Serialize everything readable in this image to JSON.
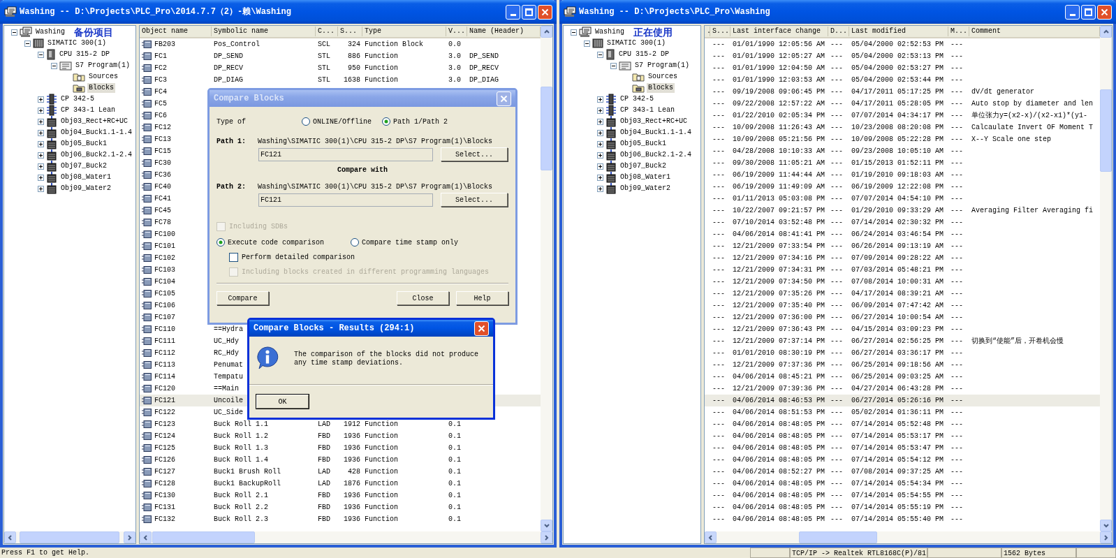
{
  "left_window": {
    "title": "Washing -- D:\\Projects\\PLC_Pro\\2014.7.7（2）-赖\\Washing",
    "tree": [
      {
        "label": "Washing",
        "kind": "project",
        "note": "备份项目",
        "expanded": true,
        "selected": false,
        "children": [
          {
            "label": "SIMATIC 300(1)",
            "kind": "station",
            "expanded": true,
            "selected": false,
            "children": [
              {
                "label": "CPU 315-2 DP",
                "kind": "cpu",
                "expanded": true,
                "selected": false,
                "children": [
                  {
                    "label": "S7 Program(1)",
                    "kind": "program",
                    "expanded": true,
                    "selected": false,
                    "children": [
                      {
                        "label": "Sources",
                        "kind": "sources",
                        "selected": false
                      },
                      {
                        "label": "Blocks",
                        "kind": "blocks",
                        "selected": true
                      }
                    ]
                  }
                ]
              },
              {
                "label": "CP 342-5",
                "kind": "cp",
                "expanded": false,
                "selected": false
              },
              {
                "label": "CP 343-1 Lean",
                "kind": "cp",
                "expanded": false,
                "selected": false
              },
              {
                "label": "Obj03_Rect+RC+UC",
                "kind": "object",
                "expanded": false,
                "selected": false
              },
              {
                "label": "Obj04_Buck1.1-1.4",
                "kind": "object",
                "expanded": false,
                "selected": false
              },
              {
                "label": "Obj05_Buck1",
                "kind": "object",
                "expanded": false,
                "selected": false
              },
              {
                "label": "Obj06_Buck2.1-2.4",
                "kind": "object",
                "expanded": false,
                "selected": false
              },
              {
                "label": "Obj07_Buck2",
                "kind": "object",
                "expanded": false,
                "selected": false
              },
              {
                "label": "Obj08_Water1",
                "kind": "object",
                "expanded": false,
                "selected": false
              },
              {
                "label": "Obj09_Water2",
                "kind": "object",
                "expanded": false,
                "selected": false
              }
            ]
          }
        ]
      }
    ],
    "table": {
      "columns": [
        "Object name",
        "Symbolic name",
        "C...",
        "S...",
        "Type",
        "V...",
        "Name (Header)"
      ],
      "rows": [
        {
          "name": "FB203",
          "symbolic": "Pos_Control",
          "lang": "SCL",
          "size": "324",
          "type": "Function Block",
          "version": "0.0",
          "selected": false
        },
        {
          "name": "FC1",
          "symbolic": "DP_SEND",
          "lang": "STL",
          "size": "886",
          "type": "Function",
          "version": "3.0",
          "header": "DP_SEND",
          "selected": false
        },
        {
          "name": "FC2",
          "symbolic": "DP_RECV",
          "lang": "STL",
          "size": "950",
          "type": "Function",
          "version": "3.0",
          "header": "DP_RECV",
          "selected": false
        },
        {
          "name": "FC3",
          "symbolic": "DP_DIAG",
          "lang": "STL",
          "size": "1638",
          "type": "Function",
          "version": "3.0",
          "header": "DP_DIAG",
          "selected": false
        },
        {
          "name": "FC4",
          "selected": false
        },
        {
          "name": "FC5",
          "selected": false
        },
        {
          "name": "FC6",
          "selected": false
        },
        {
          "name": "FC12",
          "selected": false
        },
        {
          "name": "FC13",
          "selected": false
        },
        {
          "name": "FC15",
          "selected": false
        },
        {
          "name": "FC30",
          "selected": false
        },
        {
          "name": "FC36",
          "selected": false
        },
        {
          "name": "FC40",
          "selected": false
        },
        {
          "name": "FC41",
          "selected": false
        },
        {
          "name": "FC45",
          "selected": false
        },
        {
          "name": "FC78",
          "selected": false
        },
        {
          "name": "FC100",
          "selected": false
        },
        {
          "name": "FC101",
          "selected": false
        },
        {
          "name": "FC102",
          "selected": false
        },
        {
          "name": "FC103",
          "selected": false
        },
        {
          "name": "FC104",
          "selected": false
        },
        {
          "name": "FC105",
          "selected": false
        },
        {
          "name": "FC106",
          "selected": false
        },
        {
          "name": "FC107",
          "selected": false
        },
        {
          "name": "FC110",
          "symbolic": "==Hydra",
          "selected": false
        },
        {
          "name": "FC111",
          "symbolic": "UC_Hdy",
          "selected": false
        },
        {
          "name": "FC112",
          "symbolic": "RC_Hdy",
          "selected": false
        },
        {
          "name": "FC113",
          "symbolic": "Penumat",
          "selected": false
        },
        {
          "name": "FC114",
          "symbolic": "Tempatu",
          "selected": false
        },
        {
          "name": "FC120",
          "symbolic": "==Main",
          "selected": false
        },
        {
          "name": "FC121",
          "symbolic": "Uncoile",
          "selected": true
        },
        {
          "name": "FC122",
          "symbolic": "UC_Side",
          "selected": false
        },
        {
          "name": "FC123",
          "symbolic": "Buck Roll 1.1",
          "lang": "LAD",
          "size": "1912",
          "type": "Function",
          "version": "0.1",
          "selected": false
        },
        {
          "name": "FC124",
          "symbolic": "Buck Roll 1.2",
          "lang": "FBD",
          "size": "1936",
          "type": "Function",
          "version": "0.1",
          "selected": false
        },
        {
          "name": "FC125",
          "symbolic": "Buck Roll 1.3",
          "lang": "FBD",
          "size": "1936",
          "type": "Function",
          "version": "0.1",
          "selected": false
        },
        {
          "name": "FC126",
          "symbolic": "Buck Roll 1.4",
          "lang": "FBD",
          "size": "1936",
          "type": "Function",
          "version": "0.1",
          "selected": false
        },
        {
          "name": "FC127",
          "symbolic": "Buck1 Brush Roll",
          "lang": "LAD",
          "size": "428",
          "type": "Function",
          "version": "0.1",
          "selected": false
        },
        {
          "name": "FC128",
          "symbolic": "Buck1 BackupRoll",
          "lang": "LAD",
          "size": "1876",
          "type": "Function",
          "version": "0.1",
          "selected": false
        },
        {
          "name": "FC130",
          "symbolic": "Buck Roll 2.1",
          "lang": "FBD",
          "size": "1936",
          "type": "Function",
          "version": "0.1",
          "selected": false
        },
        {
          "name": "FC131",
          "symbolic": "Buck Roll 2.2",
          "lang": "FBD",
          "size": "1936",
          "type": "Function",
          "version": "0.1",
          "selected": false
        },
        {
          "name": "FC132",
          "symbolic": "Buck Roll 2.3",
          "lang": "FBD",
          "size": "1936",
          "type": "Function",
          "version": "0.1",
          "selected": false
        }
      ]
    }
  },
  "right_window": {
    "title": "Washing -- D:\\Projects\\PLC_Pro\\Washing",
    "tree": [
      {
        "label": "Washing",
        "kind": "project",
        "note": "正在使用",
        "expanded": true,
        "selected": false,
        "children": [
          {
            "label": "SIMATIC 300(1)",
            "kind": "station",
            "expanded": true,
            "selected": false,
            "children": [
              {
                "label": "CPU 315-2 DP",
                "kind": "cpu",
                "expanded": true,
                "selected": false,
                "children": [
                  {
                    "label": "S7 Program(1)",
                    "kind": "program",
                    "expanded": true,
                    "selected": false,
                    "children": [
                      {
                        "label": "Sources",
                        "kind": "sources",
                        "selected": false
                      },
                      {
                        "label": "Blocks",
                        "kind": "blocks",
                        "selected": true
                      }
                    ]
                  }
                ]
              },
              {
                "label": "CP 342-5",
                "kind": "cp",
                "expanded": false,
                "selected": false
              },
              {
                "label": "CP 343-1 Lean",
                "kind": "cp",
                "expanded": false,
                "selected": false
              },
              {
                "label": "Obj03_Rect+RC+UC",
                "kind": "object",
                "expanded": false,
                "selected": false
              },
              {
                "label": "Obj04_Buck1.1-1.4",
                "kind": "object",
                "expanded": false,
                "selected": false
              },
              {
                "label": "Obj05_Buck1",
                "kind": "object",
                "expanded": false,
                "selected": false
              },
              {
                "label": "Obj06_Buck2.1-2.4",
                "kind": "object",
                "expanded": false,
                "selected": false
              },
              {
                "label": "Obj07_Buck2",
                "kind": "object",
                "expanded": false,
                "selected": false
              },
              {
                "label": "Obj08_Water1",
                "kind": "object",
                "expanded": false,
                "selected": false
              },
              {
                "label": "Obj09_Water2",
                "kind": "object",
                "expanded": false,
                "selected": false
              }
            ]
          }
        ]
      }
    ],
    "table": {
      "columns": [
        ".",
        "S...",
        "Last interface change",
        "D...",
        "Last modified",
        "M...",
        "Comment"
      ],
      "rows": [
        {
          "s": "---",
          "last_interface_change": "01/01/1990 12:05:56 AM",
          "d": "---",
          "last_modified": "05/04/2000 02:52:53 PM",
          "m": "---",
          "selected": false
        },
        {
          "s": "---",
          "last_interface_change": "01/01/1990 12:05:27 AM",
          "d": "---",
          "last_modified": "05/04/2000 02:53:13 PM",
          "m": "---",
          "selected": false
        },
        {
          "s": "---",
          "last_interface_change": "01/01/1990 12:04:50 AM",
          "d": "---",
          "last_modified": "05/04/2000 02:53:27 PM",
          "m": "---",
          "selected": false
        },
        {
          "s": "---",
          "last_interface_change": "01/01/1990 12:03:53 AM",
          "d": "---",
          "last_modified": "05/04/2000 02:53:44 PM",
          "m": "---",
          "selected": false
        },
        {
          "s": "---",
          "last_interface_change": "09/19/2008 09:06:45 PM",
          "d": "---",
          "last_modified": "04/17/2011 05:17:25 PM",
          "m": "---",
          "comment": "dV/dt generator",
          "selected": false
        },
        {
          "s": "---",
          "last_interface_change": "09/22/2008 12:57:22 AM",
          "d": "---",
          "last_modified": "04/17/2011 05:28:05 PM",
          "m": "---",
          "comment": "Auto stop by diameter and len",
          "selected": false
        },
        {
          "s": "---",
          "last_interface_change": "01/22/2010 02:05:34 PM",
          "d": "---",
          "last_modified": "07/07/2014 04:34:17 PM",
          "m": "---",
          "comment": "单位张力y=(x2-x)/(x2-x1)*(y1-",
          "selected": false
        },
        {
          "s": "---",
          "last_interface_change": "10/09/2008 11:26:43 AM",
          "d": "---",
          "last_modified": "10/23/2008 08:20:08 PM",
          "m": "---",
          "comment": "Calcaulate Invert OF Moment T",
          "selected": false
        },
        {
          "s": "---",
          "last_interface_change": "10/09/2008 05:21:56 PM",
          "d": "---",
          "last_modified": "10/09/2008 05:22:28 PM",
          "m": "---",
          "comment": "X--Y Scale one step",
          "selected": false
        },
        {
          "s": "---",
          "last_interface_change": "04/28/2008 10:10:33 AM",
          "d": "---",
          "last_modified": "09/23/2008 10:05:10 AM",
          "m": "---",
          "selected": false
        },
        {
          "s": "---",
          "last_interface_change": "09/30/2008 11:05:21 AM",
          "d": "---",
          "last_modified": "01/15/2013 01:52:11 PM",
          "m": "---",
          "selected": false
        },
        {
          "s": "---",
          "last_interface_change": "06/19/2009 11:44:44 AM",
          "d": "---",
          "last_modified": "01/19/2010 09:18:03 AM",
          "m": "---",
          "selected": false
        },
        {
          "s": "---",
          "last_interface_change": "06/19/2009 11:49:09 AM",
          "d": "---",
          "last_modified": "06/19/2009 12:22:08 PM",
          "m": "---",
          "selected": false
        },
        {
          "s": "---",
          "last_interface_change": "01/11/2013 05:03:08 PM",
          "d": "---",
          "last_modified": "07/07/2014 04:54:10 PM",
          "m": "---",
          "selected": false
        },
        {
          "s": "---",
          "last_interface_change": "10/22/2007 09:21:57 PM",
          "d": "---",
          "last_modified": "01/29/2010 09:33:29 AM",
          "m": "---",
          "comment": "Averaging Filter Averaging fi",
          "selected": false
        },
        {
          "s": "---",
          "last_interface_change": "07/10/2014 03:52:48 PM",
          "d": "---",
          "last_modified": "07/14/2014 02:30:32 PM",
          "m": "---",
          "selected": false
        },
        {
          "s": "---",
          "last_interface_change": "04/06/2014 08:41:41 PM",
          "d": "---",
          "last_modified": "06/24/2014 03:46:54 PM",
          "m": "---",
          "selected": false
        },
        {
          "s": "---",
          "last_interface_change": "12/21/2009 07:33:54 PM",
          "d": "---",
          "last_modified": "06/26/2014 09:13:19 AM",
          "m": "---",
          "selected": false
        },
        {
          "s": "---",
          "last_interface_change": "12/21/2009 07:34:16 PM",
          "d": "---",
          "last_modified": "07/09/2014 09:28:22 AM",
          "m": "---",
          "selected": false
        },
        {
          "s": "---",
          "last_interface_change": "12/21/2009 07:34:31 PM",
          "d": "---",
          "last_modified": "07/03/2014 05:48:21 PM",
          "m": "---",
          "selected": false
        },
        {
          "s": "---",
          "last_interface_change": "12/21/2009 07:34:50 PM",
          "d": "---",
          "last_modified": "07/08/2014 10:00:31 AM",
          "m": "---",
          "selected": false
        },
        {
          "s": "---",
          "last_interface_change": "12/21/2009 07:35:26 PM",
          "d": "---",
          "last_modified": "04/17/2014 08:39:21 AM",
          "m": "---",
          "selected": false
        },
        {
          "s": "---",
          "last_interface_change": "12/21/2009 07:35:40 PM",
          "d": "---",
          "last_modified": "06/09/2014 07:47:42 AM",
          "m": "---",
          "selected": false
        },
        {
          "s": "---",
          "last_interface_change": "12/21/2009 07:36:00 PM",
          "d": "---",
          "last_modified": "06/27/2014 10:00:54 AM",
          "m": "---",
          "selected": false
        },
        {
          "s": "---",
          "last_interface_change": "12/21/2009 07:36:43 PM",
          "d": "---",
          "last_modified": "04/15/2014 03:09:23 PM",
          "m": "---",
          "selected": false
        },
        {
          "s": "---",
          "last_interface_change": "12/21/2009 07:37:14 PM",
          "d": "---",
          "last_modified": "06/27/2014 02:56:25 PM",
          "m": "---",
          "comment": "切换到“使能”后，开卷机会慢",
          "selected": false
        },
        {
          "s": "---",
          "last_interface_change": "01/01/2010 08:30:19 PM",
          "d": "---",
          "last_modified": "06/27/2014 03:36:17 PM",
          "m": "---",
          "selected": false
        },
        {
          "s": "---",
          "last_interface_change": "12/21/2009 07:37:36 PM",
          "d": "---",
          "last_modified": "06/25/2014 09:18:56 AM",
          "m": "---",
          "selected": false
        },
        {
          "s": "---",
          "last_interface_change": "04/06/2014 08:45:21 PM",
          "d": "---",
          "last_modified": "06/25/2014 09:03:25 AM",
          "m": "---",
          "selected": false
        },
        {
          "s": "---",
          "last_interface_change": "12/21/2009 07:39:36 PM",
          "d": "---",
          "last_modified": "04/27/2014 06:43:28 PM",
          "m": "---",
          "selected": false
        },
        {
          "s": "---",
          "last_interface_change": "04/06/2014 08:46:53 PM",
          "d": "---",
          "last_modified": "06/27/2014 05:26:16 PM",
          "m": "---",
          "selected": true
        },
        {
          "s": "---",
          "last_interface_change": "04/06/2014 08:51:53 PM",
          "d": "---",
          "last_modified": "05/02/2014 01:36:11 PM",
          "m": "---",
          "selected": false
        },
        {
          "s": "---",
          "last_interface_change": "04/06/2014 08:48:05 PM",
          "d": "---",
          "last_modified": "07/14/2014 05:52:48 PM",
          "m": "---",
          "selected": false
        },
        {
          "s": "---",
          "last_interface_change": "04/06/2014 08:48:05 PM",
          "d": "---",
          "last_modified": "07/14/2014 05:53:17 PM",
          "m": "---",
          "selected": false
        },
        {
          "s": "---",
          "last_interface_change": "04/06/2014 08:48:05 PM",
          "d": "---",
          "last_modified": "07/14/2014 05:53:47 PM",
          "m": "---",
          "selected": false
        },
        {
          "s": "---",
          "last_interface_change": "04/06/2014 08:48:05 PM",
          "d": "---",
          "last_modified": "07/14/2014 05:54:12 PM",
          "m": "---",
          "selected": false
        },
        {
          "s": "---",
          "last_interface_change": "04/06/2014 08:52:27 PM",
          "d": "---",
          "last_modified": "07/08/2014 09:37:25 AM",
          "m": "---",
          "selected": false
        },
        {
          "s": "---",
          "last_interface_change": "04/06/2014 08:48:05 PM",
          "d": "---",
          "last_modified": "07/14/2014 05:54:34 PM",
          "m": "---",
          "selected": false
        },
        {
          "s": "---",
          "last_interface_change": "04/06/2014 08:48:05 PM",
          "d": "---",
          "last_modified": "07/14/2014 05:54:55 PM",
          "m": "---",
          "selected": false
        },
        {
          "s": "---",
          "last_interface_change": "04/06/2014 08:48:05 PM",
          "d": "---",
          "last_modified": "07/14/2014 05:55:19 PM",
          "m": "---",
          "selected": false
        },
        {
          "s": "---",
          "last_interface_change": "04/06/2014 08:48:05 PM",
          "d": "---",
          "last_modified": "07/14/2014 05:55:40 PM",
          "m": "---",
          "selected": false
        }
      ]
    }
  },
  "compare_dialog": {
    "title": "Compare Blocks",
    "active": false,
    "type_label": "Type of",
    "type_options": [
      {
        "label": "ONLINE/Offline",
        "selected": false
      },
      {
        "label": "Path 1/Path 2",
        "selected": true
      }
    ],
    "paths": [
      {
        "label": "Path 1:",
        "path": "Washing\\SIMATIC 300(1)\\CPU 315-2 DP\\S7 Program(1)\\Blocks",
        "value": "FC121",
        "button": "Select..."
      },
      {
        "label": "Path 2:",
        "path": "Washing\\SIMATIC 300(1)\\CPU 315-2 DP\\S7 Program(1)\\Blocks",
        "value": "FC121",
        "button": "Select..."
      }
    ],
    "compare_with": "Compare with",
    "including_sdbs": {
      "label": "Including SDBs",
      "checked": false,
      "disabled": true
    },
    "mode_options": [
      {
        "label": "Execute code comparison",
        "selected": true
      },
      {
        "label": "Compare time stamp only",
        "selected": false
      }
    ],
    "options": [
      {
        "label": "Perform detailed comparison",
        "checked": false,
        "disabled": false
      },
      {
        "label": "Including blocks created in different programming languages",
        "checked": false,
        "disabled": true
      }
    ],
    "buttons": [
      "Compare",
      "Close",
      "Help"
    ]
  },
  "results_dialog": {
    "title": "Compare Blocks - Results (294:1)",
    "active": true,
    "message": "The comparison of the blocks did not produce any time stamp deviations.",
    "button": "OK"
  },
  "status_bar": {
    "text": "Press F1 to get Help.",
    "panes": [
      "TCP/IP -> Realtek RTL8168C(P)/81",
      "1562 Bytes"
    ]
  }
}
